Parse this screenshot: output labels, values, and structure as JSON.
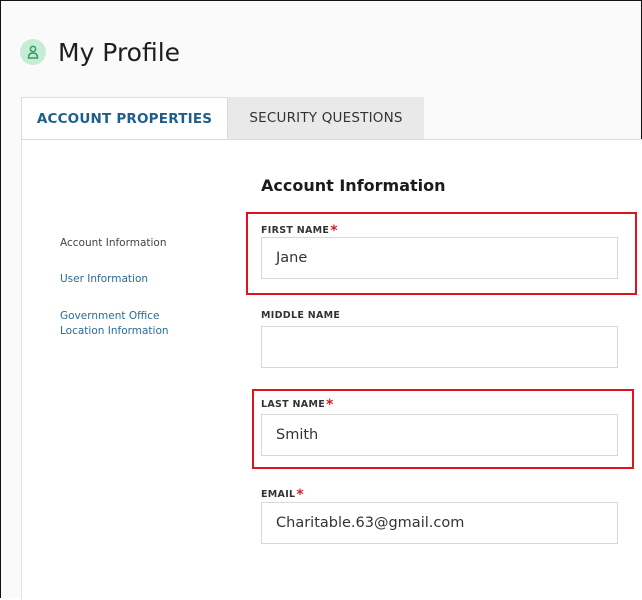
{
  "header": {
    "title": "My Profile",
    "icon": "user-icon"
  },
  "tabs": [
    {
      "label": "ACCOUNT PROPERTIES",
      "active": true
    },
    {
      "label": "SECURITY QUESTIONS",
      "active": false
    }
  ],
  "sidebar": {
    "items": [
      {
        "label": "Account Information"
      },
      {
        "label": "User Information"
      },
      {
        "label": "Government Office Location Information"
      }
    ]
  },
  "form": {
    "heading": "Account Information",
    "required_marker": "*",
    "fields": {
      "first_name": {
        "label": "FIRST NAME",
        "value": "Jane",
        "required": true
      },
      "middle_name": {
        "label": "MIDDLE NAME",
        "value": "",
        "required": false
      },
      "last_name": {
        "label": "LAST NAME",
        "value": "Smith",
        "required": true
      },
      "email": {
        "label": "EMAIL",
        "value": "Charitable.63@gmail.com",
        "required": true
      }
    }
  },
  "colors": {
    "accent": "#1d5f8c",
    "required": "#c0262d",
    "highlight": "#e0121c",
    "icon_bg": "#c6ecd6"
  }
}
